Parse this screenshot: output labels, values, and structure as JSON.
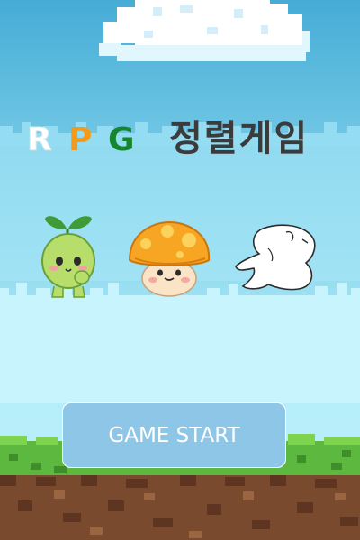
{
  "title": {
    "letters": [
      "R",
      "P",
      "G"
    ],
    "korean": "정렬게임"
  },
  "start_button": {
    "label": "GAME START"
  },
  "characters": [
    "sprout-character",
    "orange-mushroom-character",
    "ghost-outline-character"
  ],
  "colors": {
    "sky_top": "#4fb3d8",
    "sky_bottom": "#bdf0fb",
    "letter_r": "#ffffff",
    "letter_p": "#f39a1a",
    "letter_g": "#16852f",
    "korean_text": "#3b3b3b",
    "button_bg": "#8ec6e8",
    "grass": "#5cb83e",
    "dirt": "#7a4a2e"
  }
}
